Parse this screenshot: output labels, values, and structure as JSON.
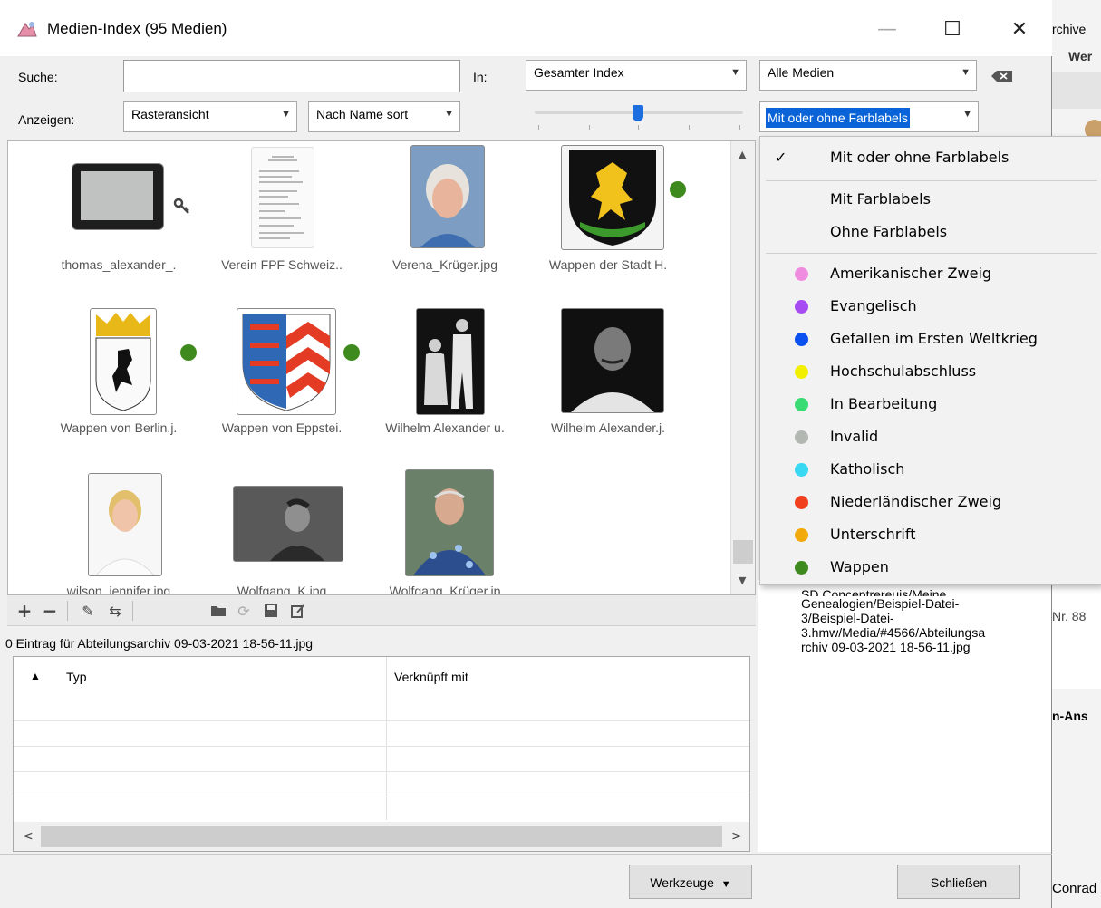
{
  "window": {
    "title": "Medien-Index (95 Medien)"
  },
  "window_controls": {
    "minimize": "—",
    "maximize": "☐",
    "close": "✕"
  },
  "search": {
    "label": "Suche:",
    "value": "",
    "in_label": "In:",
    "scope": "Gesamter Index",
    "media_filter": "Alle Medien"
  },
  "display": {
    "label": "Anzeigen:",
    "view": "Rasteransicht",
    "sort": "Nach Name sort",
    "color_filter": "Mit oder ohne Farblabels"
  },
  "grid": {
    "items": [
      {
        "caption": "thomas_alexander_.",
        "kind": "tablet",
        "dot": false,
        "key": true
      },
      {
        "caption": "Verein FPF Schweiz..",
        "kind": "document",
        "dot": false
      },
      {
        "caption": "Verena_Krüger.jpg",
        "kind": "portrait-color",
        "dot": false
      },
      {
        "caption": "Wappen der Stadt H.",
        "kind": "crest-heidelberg",
        "dot": true
      },
      {
        "caption": "Wappen von Berlin.j.",
        "kind": "crest-berlin",
        "dot": true
      },
      {
        "caption": "Wappen von Eppstei.",
        "kind": "crest-eppstein",
        "dot": true
      },
      {
        "caption": "Wilhelm Alexander u.",
        "kind": "photo-bw-couple",
        "dot": false
      },
      {
        "caption": "Wilhelm Alexander.j.",
        "kind": "photo-bw-man",
        "dot": false
      },
      {
        "caption": "wilson_jennifer.jpg",
        "kind": "portrait-woman",
        "dot": false
      },
      {
        "caption": "Wolfgang_K.jpg",
        "kind": "photo-bw-child",
        "dot": false
      },
      {
        "caption": "Wolfgang_Krüger.jp",
        "kind": "portrait-man",
        "dot": false
      }
    ]
  },
  "toolbar": {
    "icons": [
      "add-icon",
      "remove-icon",
      "edit-icon",
      "merge-icon",
      "folder-icon",
      "refresh-icon",
      "save-icon",
      "edit-note-icon"
    ]
  },
  "status": {
    "entry": "0 Eintrag für Abteilungsarchiv 09-03-2021 18-56-11.jpg"
  },
  "table": {
    "sort_indicator": "▲",
    "col_type": "Typ",
    "col_linked": "Verknüpft mit"
  },
  "info": {
    "line0": "SD Conceptrereuis/Meine",
    "line1": "Genealogien/Beispiel-Datei-",
    "line2": "3/Beispiel-Datei-",
    "line3": "3.hmw/Media/#4566/Abteilungsa",
    "line4": "rchiv 09-03-2021 18-56-11.jpg"
  },
  "color_menu": {
    "check": "✓",
    "items": [
      {
        "label": "Mit oder ohne Farblabels",
        "checked": true
      },
      {
        "label": "Mit Farblabels"
      },
      {
        "label": "Ohne Farblabels"
      },
      {
        "label": "Amerikanischer Zweig",
        "color": "#f08ce0"
      },
      {
        "label": "Evangelisch",
        "color": "#a64cf0"
      },
      {
        "label": "Gefallen im Ersten Weltkrieg",
        "color": "#0a50f0"
      },
      {
        "label": "Hochschulabschluss",
        "color": "#f2f000"
      },
      {
        "label": "In Bearbeitung",
        "color": "#3adb72"
      },
      {
        "label": "Invalid",
        "color": "#b2b7b2"
      },
      {
        "label": "Katholisch",
        "color": "#38d8f2"
      },
      {
        "label": "Niederländischer Zweig",
        "color": "#f0401e"
      },
      {
        "label": "Unterschrift",
        "color": "#f2aa0a"
      },
      {
        "label": "Wappen",
        "color": "#3f8a1f"
      }
    ]
  },
  "buttons": {
    "tools": "Werkzeuge",
    "close": "Schließen"
  },
  "background_app": {
    "t1": "rchive",
    "t2": "Wer",
    "t3": "Nr. 88",
    "t4": "n-Ans",
    "t5": "Conrad"
  }
}
